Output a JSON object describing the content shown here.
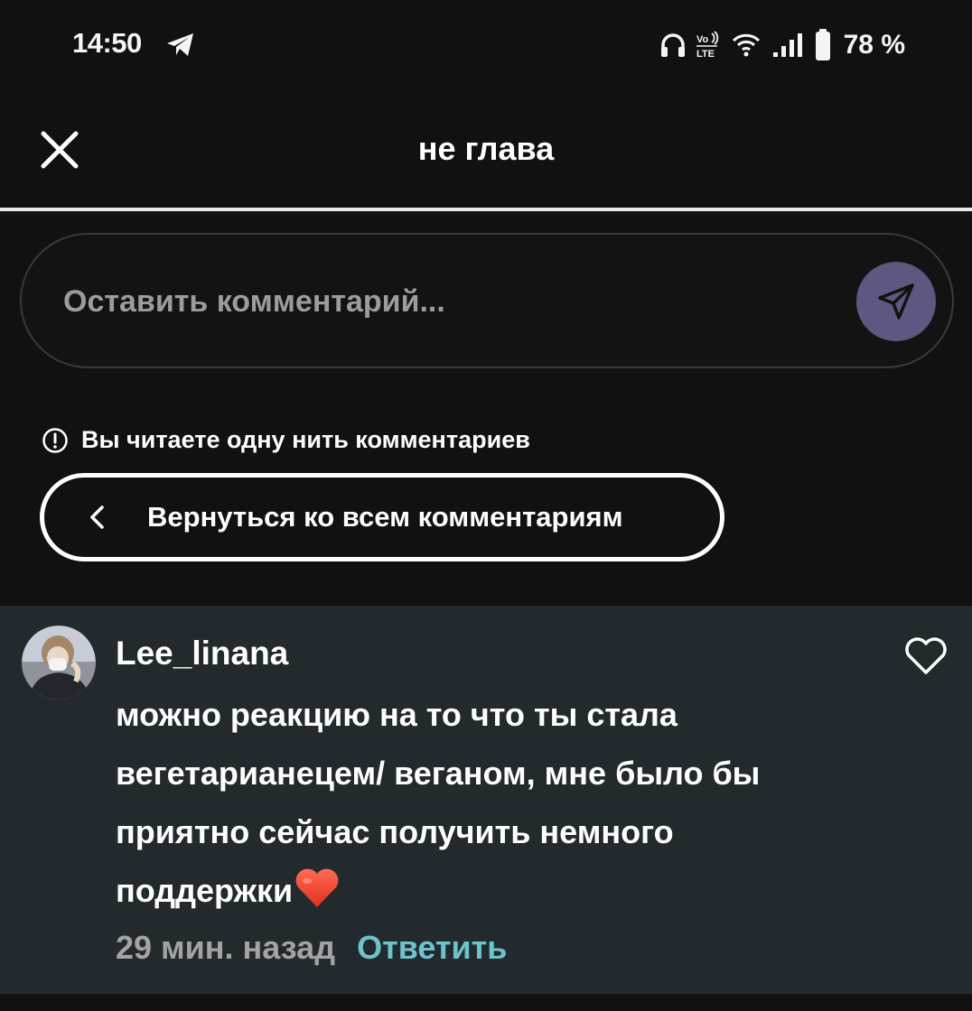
{
  "status_bar": {
    "time": "14:50",
    "battery": "78 %",
    "icons": [
      "telegram-icon",
      "headphones-icon",
      "volte-icon",
      "wifi-icon",
      "signal-icon",
      "battery-icon"
    ]
  },
  "header": {
    "title": "не глава",
    "close_icon": "close-icon"
  },
  "comment_input": {
    "placeholder": "Оставить комментарий...",
    "value": "",
    "send_icon": "send-icon",
    "send_color": "#5d5781"
  },
  "thread_notice": {
    "icon": "info-icon",
    "text": "Вы читаете одну нить комментариев"
  },
  "back_button": {
    "icon": "chevron-left-icon",
    "label": "Вернуться ко всем комментариям"
  },
  "comment": {
    "username": "Lee_linana",
    "lines": [
      "можно реакцию на то что ты стала",
      "вегетарианецем/ веганом, мне было бы",
      "приятно сейчас получить немного",
      "поддержки"
    ],
    "emoji": "heart-emoji",
    "time": "29 мин. назад",
    "reply_label": "Ответить",
    "reply_color": "#6ec2cc",
    "like_icon": "heart-outline-icon",
    "background": "#222a2d"
  }
}
